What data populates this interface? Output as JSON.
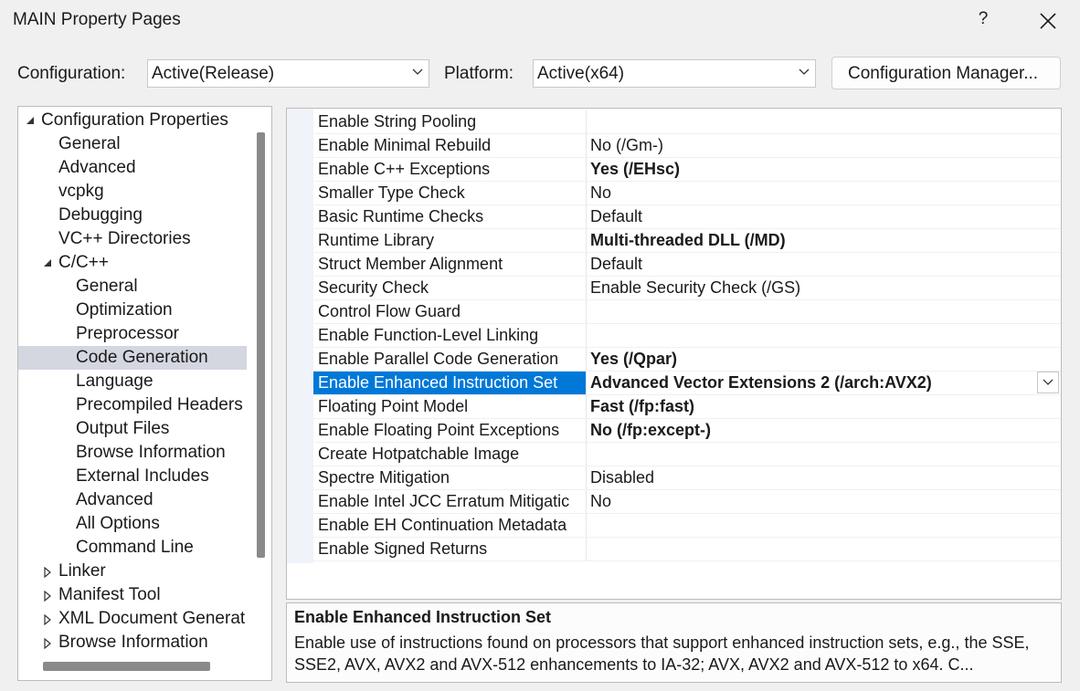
{
  "window": {
    "title": "MAIN Property Pages",
    "help_label": "?",
    "close_icon": "close-icon"
  },
  "toolbar": {
    "configuration_label": "Configuration:",
    "configuration_value": "Active(Release)",
    "platform_label": "Platform:",
    "platform_value": "Active(x64)",
    "config_manager_label": "Configuration Manager..."
  },
  "tree": {
    "items": [
      {
        "label": "Configuration Properties",
        "expander": "expanded"
      },
      {
        "label": "General"
      },
      {
        "label": "Advanced"
      },
      {
        "label": "vcpkg"
      },
      {
        "label": "Debugging"
      },
      {
        "label": "VC++ Directories"
      },
      {
        "label": "C/C++",
        "expander": "expanded"
      },
      {
        "label": "General"
      },
      {
        "label": "Optimization"
      },
      {
        "label": "Preprocessor"
      },
      {
        "label": "Code Generation",
        "selected": true
      },
      {
        "label": "Language"
      },
      {
        "label": "Precompiled Headers"
      },
      {
        "label": "Output Files"
      },
      {
        "label": "Browse Information"
      },
      {
        "label": "External Includes"
      },
      {
        "label": "Advanced"
      },
      {
        "label": "All Options"
      },
      {
        "label": "Command Line"
      },
      {
        "label": "Linker",
        "expander": "collapsed"
      },
      {
        "label": "Manifest Tool",
        "expander": "collapsed"
      },
      {
        "label": "XML Document Generat",
        "expander": "collapsed"
      },
      {
        "label": "Browse Information",
        "expander": "collapsed"
      }
    ]
  },
  "grid": {
    "rows": [
      {
        "name": "Enable String Pooling",
        "value": ""
      },
      {
        "name": "Enable Minimal Rebuild",
        "value": "No (/Gm-)"
      },
      {
        "name": "Enable C++ Exceptions",
        "value": "Yes (/EHsc)",
        "bold": true
      },
      {
        "name": "Smaller Type Check",
        "value": "No"
      },
      {
        "name": "Basic Runtime Checks",
        "value": "Default"
      },
      {
        "name": "Runtime Library",
        "value": "Multi-threaded DLL (/MD)",
        "bold": true
      },
      {
        "name": "Struct Member Alignment",
        "value": "Default"
      },
      {
        "name": "Security Check",
        "value": "Enable Security Check (/GS)"
      },
      {
        "name": "Control Flow Guard",
        "value": ""
      },
      {
        "name": "Enable Function-Level Linking",
        "value": ""
      },
      {
        "name": "Enable Parallel Code Generation",
        "value": "Yes (/Qpar)",
        "bold": true
      },
      {
        "name": "Enable Enhanced Instruction Set",
        "value": "Advanced Vector Extensions 2 (/arch:AVX2)",
        "bold": true,
        "selected": true
      },
      {
        "name": "Floating Point Model",
        "value": "Fast (/fp:fast)",
        "bold": true
      },
      {
        "name": "Enable Floating Point Exceptions",
        "value": "No (/fp:except-)",
        "bold": true
      },
      {
        "name": "Create Hotpatchable Image",
        "value": ""
      },
      {
        "name": "Spectre Mitigation",
        "value": "Disabled"
      },
      {
        "name": "Enable Intel JCC Erratum Mitigatic",
        "value": "No"
      },
      {
        "name": "Enable EH Continuation Metadata",
        "value": ""
      },
      {
        "name": "Enable Signed Returns",
        "value": ""
      }
    ]
  },
  "description": {
    "title": "Enable Enhanced Instruction Set",
    "text": "Enable use of instructions found on processors that support enhanced instruction sets, e.g., the SSE, SSE2, AVX, AVX2 and AVX-512 enhancements to IA-32; AVX, AVX2 and AVX-512 to x64. C..."
  },
  "colors": {
    "selection_blue": "#0078d7",
    "tree_selection": "#d4d7e0"
  }
}
